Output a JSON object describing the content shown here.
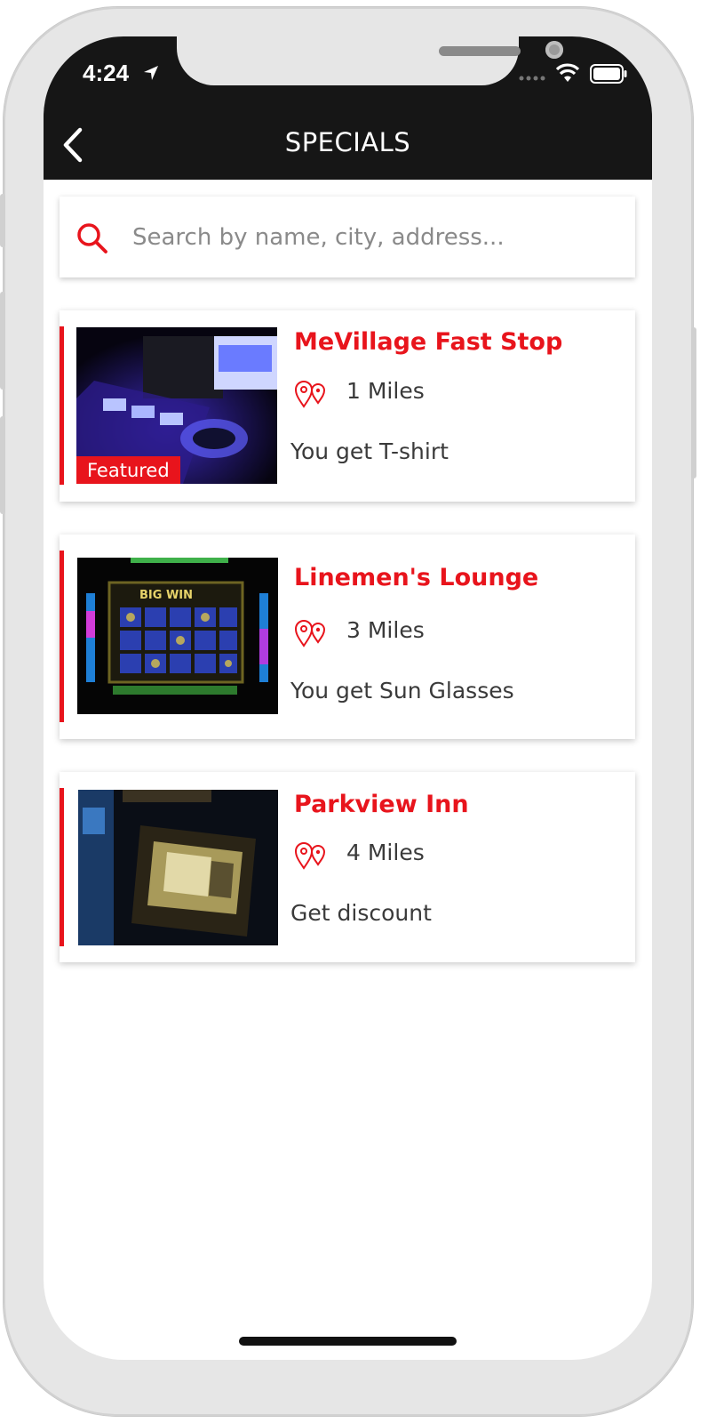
{
  "status_bar": {
    "time": "4:24"
  },
  "header": {
    "title": "SPECIALS"
  },
  "search": {
    "placeholder": "Search by name, city, address..."
  },
  "specials": [
    {
      "name": "MeVillage Fast Stop",
      "distance": "1 Miles",
      "offer": "You get T-shirt",
      "badge": "Featured"
    },
    {
      "name": "Linemen's Lounge",
      "distance": "3 Miles",
      "offer": "You get Sun Glasses"
    },
    {
      "name": "Parkview Inn",
      "distance": "4 Miles",
      "offer": "Get discount"
    }
  ],
  "colors": {
    "accent": "#e8141c",
    "header_bg": "#161616",
    "text": "#3a3a3a"
  },
  "icons": [
    "back-chevron-icon",
    "search-icon",
    "map-pin-icon",
    "location-arrow-icon",
    "wifi-icon",
    "battery-icon"
  ]
}
